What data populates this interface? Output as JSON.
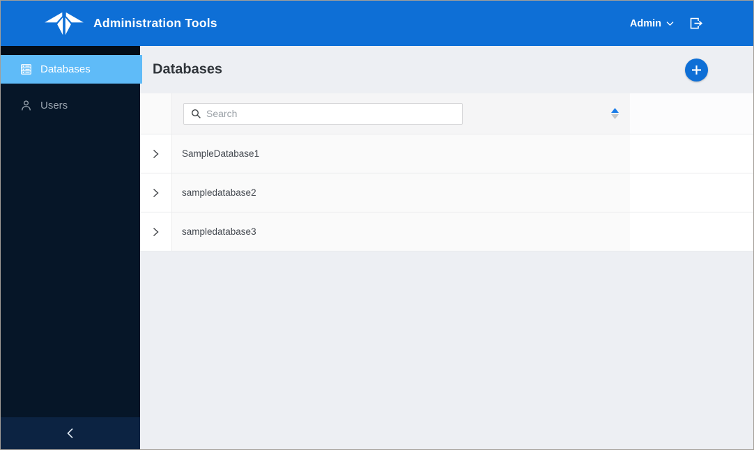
{
  "header": {
    "brand": "Administration Tools",
    "user_menu": {
      "label": "Admin"
    }
  },
  "sidebar": {
    "items": [
      {
        "label": "Databases",
        "icon": "database-grid-icon",
        "active": true
      },
      {
        "label": "Users",
        "icon": "user-icon",
        "active": false
      }
    ]
  },
  "main": {
    "page_title": "Databases",
    "toolbar": {
      "search_placeholder": "Search",
      "sort_state": "ascending"
    },
    "table": {
      "rows": [
        {
          "name": "SampleDatabase1"
        },
        {
          "name": "sampledatabase2"
        },
        {
          "name": "sampledatabase3"
        }
      ]
    }
  },
  "colors": {
    "header_blue": "#0e6fd6",
    "accent_blue": "#0e6fd6",
    "active_item_blue": "#5fbbf8",
    "sidebar_navy": "#061628",
    "sidebar_footer_navy": "#0c2342",
    "main_background": "#edeff3",
    "sort_asc_active": "#1a7ce8",
    "sort_desc_inactive": "#c3c6c9"
  }
}
